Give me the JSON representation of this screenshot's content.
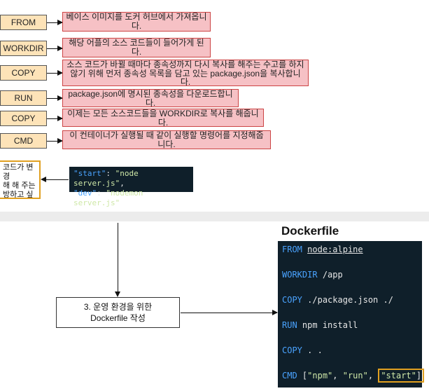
{
  "rows": [
    {
      "keyword": "FROM",
      "desc": "베이스 이미지를 도커 허브에서 가져옵니다."
    },
    {
      "keyword": "WORKDIR",
      "desc": "해당 어플의 소스 코드들이 들어가게 된다."
    },
    {
      "keyword": "COPY",
      "desc": "소스 코드가 바뀔 때마다 종속성까지 다시 복사를 해주는 수고를 하지 않기 위해 먼저 종속성 목록을 담고 있는 package.json을 복사합니다."
    },
    {
      "keyword": "RUN",
      "desc": "package.json에 명시된 종속성을 다운로드합니다."
    },
    {
      "keyword": "COPY",
      "desc": "이제는 모든 소스코드들을 WORKDIR로 복사를 해줍니다."
    },
    {
      "keyword": "CMD",
      "desc": "이 컨테이너가 실행될 때 같이 실행할 명령어를 지정해줍니다."
    }
  ],
  "note": {
    "lines": [
      "코드가 변경",
      "해 해 주는",
      "방하고 싶기"
    ]
  },
  "scripts": {
    "start_key": "\"start\"",
    "start_val": "\"node server.js\"",
    "dev_key": "\"dev\"",
    "dev_val": "\"nodemon server.js\""
  },
  "step_box": {
    "line1": "3. 운영 환경을 위한",
    "line2": "Dockerfile 작성"
  },
  "dockerfile": {
    "title": "Dockerfile",
    "lines": [
      {
        "kw": "FROM",
        "rest": "node:alpine"
      },
      {
        "kw": "WORKDIR",
        "rest": "/app"
      },
      {
        "kw": "COPY",
        "rest": "./package.json ./"
      },
      {
        "kw": "RUN",
        "rest": "npm install"
      },
      {
        "kw": "COPY",
        "rest": ". ."
      },
      {
        "kw": "CMD",
        "rest": "[\"npm\", \"run\", \"start\"]"
      }
    ],
    "cmd_parts": {
      "open": "[",
      "npm": "\"npm\"",
      "sep1": ", ",
      "run": "\"run\"",
      "sep2": ", ",
      "start": "\"start\"",
      "close": "]"
    }
  },
  "colors": {
    "keyword_fill": "#fde3b8",
    "desc_fill": "#f6c1c5",
    "code_bg": "#0f1f2a",
    "highlight": "#e0a020"
  }
}
